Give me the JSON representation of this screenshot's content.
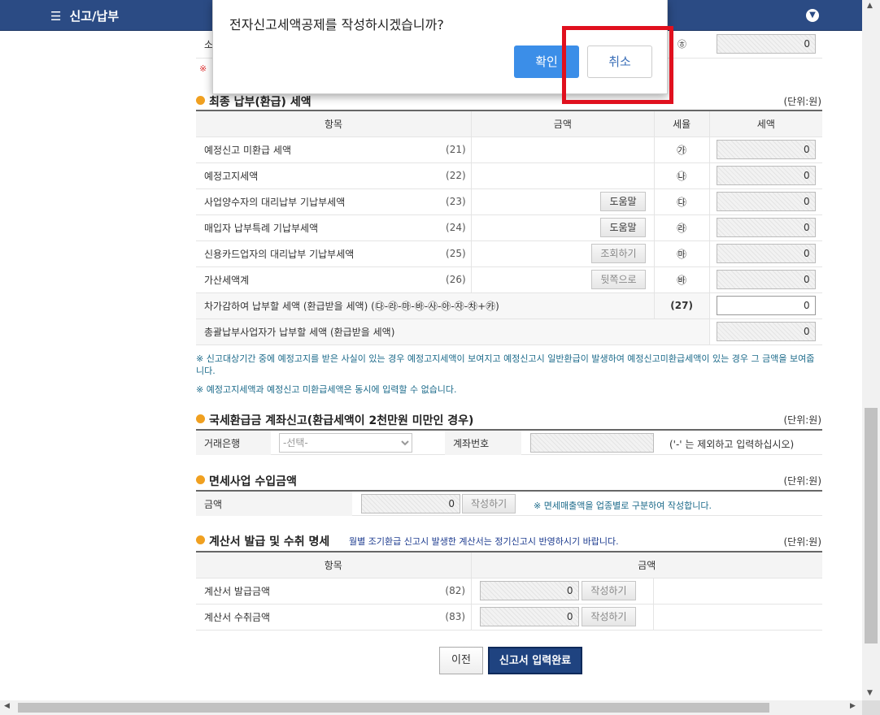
{
  "topbar": {
    "menu_label": "신고/납부"
  },
  "dialog": {
    "message": "전자신고세액공제를 작성하시겠습니까?",
    "ok_label": "확인",
    "cancel_label": "취소"
  },
  "top_partial": {
    "label": "소",
    "rate": "㉭",
    "tax": "0",
    "note_mark": "※"
  },
  "final_section": {
    "title": "최종 납부(환급) 세액",
    "unit": "(단위:원)",
    "headers": [
      "항목",
      "금액",
      "세율",
      "세액"
    ],
    "rows": [
      {
        "label": "예정신고 미환급 세액",
        "num": "(21)",
        "button": "",
        "rate": "㉮",
        "tax": "0"
      },
      {
        "label": "예정고지세액",
        "num": "(22)",
        "button": "",
        "rate": "㉯",
        "tax": "0"
      },
      {
        "label": "사업양수자의 대리납부 기납부세액",
        "num": "(23)",
        "button": "도움말",
        "rate": "㉰",
        "tax": "0"
      },
      {
        "label": "매입자 납부특례 기납부세액",
        "num": "(24)",
        "button": "도움말",
        "rate": "㉱",
        "tax": "0"
      },
      {
        "label": "신용카드업자의 대리납부 기납부세액",
        "num": "(25)",
        "button": "조회하기",
        "rate": "㉲",
        "tax": "0"
      },
      {
        "label": "가산세액계",
        "num": "(26)",
        "button": "뒷쪽으로",
        "rate": "㉳",
        "tax": "0"
      }
    ],
    "subtract_row": {
      "label": "차가감하여 납부할 세액 (환급받을 세액) (㉰-㉱-㉲-㉳-㉴-㉵-㉶-㉷+㉸)",
      "num": "(27)",
      "tax": "0"
    },
    "total_row": {
      "label": "총괄납부사업자가 납부할 세액 (환급받을 세액)",
      "tax": "0"
    },
    "note1": "※ 신고대상기간 중에 예정고지를 받은 사실이 있는 경우 예정고지세액이 보여지고 예정신고시 일반환급이 발생하여 예정신고미환급세액이 있는 경우 그 금액을 보여줍니다.",
    "note2": "※ 예정고지세액과 예정신고 미환급세액은 동시에 입력할 수 없습니다."
  },
  "refund_section": {
    "title": "국세환급금 계좌신고(환급세액이 2천만원 미만인 경우)",
    "unit": "(단위:원)",
    "bank_label": "거래은행",
    "bank_placeholder": "-선택-",
    "account_label": "계좌번호",
    "account_hint": "('-' 는 제외하고 입력하십시오)"
  },
  "exempt_section": {
    "title": "면세사업 수입금액",
    "unit": "(단위:원)",
    "amount_label": "금액",
    "amount_value": "0",
    "write_label": "작성하기",
    "note": "※ 면세매출액을 업종별로 구분하여 작성합니다."
  },
  "invoice_section": {
    "title": "계산서 발급 및 수취 명세",
    "subnote": "월별 조기환급 신고시 발생한 계산서는 정기신고시 반영하시기 바랍니다.",
    "unit": "(단위:원)",
    "headers": [
      "항목",
      "금액"
    ],
    "rows": [
      {
        "label": "계산서 발급금액",
        "num": "(82)",
        "value": "0",
        "button": "작성하기"
      },
      {
        "label": "계산서 수취금액",
        "num": "(83)",
        "value": "0",
        "button": "작성하기"
      }
    ]
  },
  "footer": {
    "prev_label": "이전",
    "done_label": "신고서 입력완료"
  }
}
